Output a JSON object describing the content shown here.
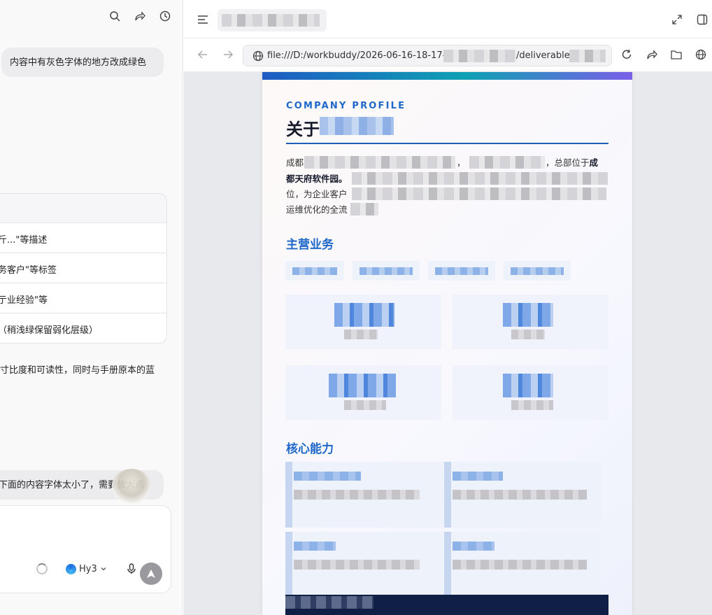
{
  "chat": {
    "user_message_1": "内容中有灰色字体的地方改成绿色",
    "table_rows": [
      "斤...\"等描述",
      "务客户\"等标签",
      "亍业经验\"等",
      "（稍浅绿保留弱化层级）"
    ],
    "assistant_text": "寸比度和可读性，同时与手册原本的蓝",
    "user_message_2": "下面的内容字体太小了，需要放大点",
    "model_name": "Hy3"
  },
  "browser": {
    "url_prefix": "file:///D:/workbuddy/2026-06-16-18-17-46",
    "url_mid": "/deliverables/"
  },
  "doc": {
    "eyebrow": "COMPANY PROFILE",
    "title_prefix": "关于",
    "para_line1_a": "成都",
    "para_line1_b": "，",
    "para_line1_c": "，总部位于",
    "para_line1_bold": "成",
    "para_line2_bold": "都天府软件园。",
    "para_line3": "位，为企业客户",
    "para_line4": "运维优化的全流",
    "section_business": "主营业务",
    "section_capabilities": "核心能力"
  }
}
